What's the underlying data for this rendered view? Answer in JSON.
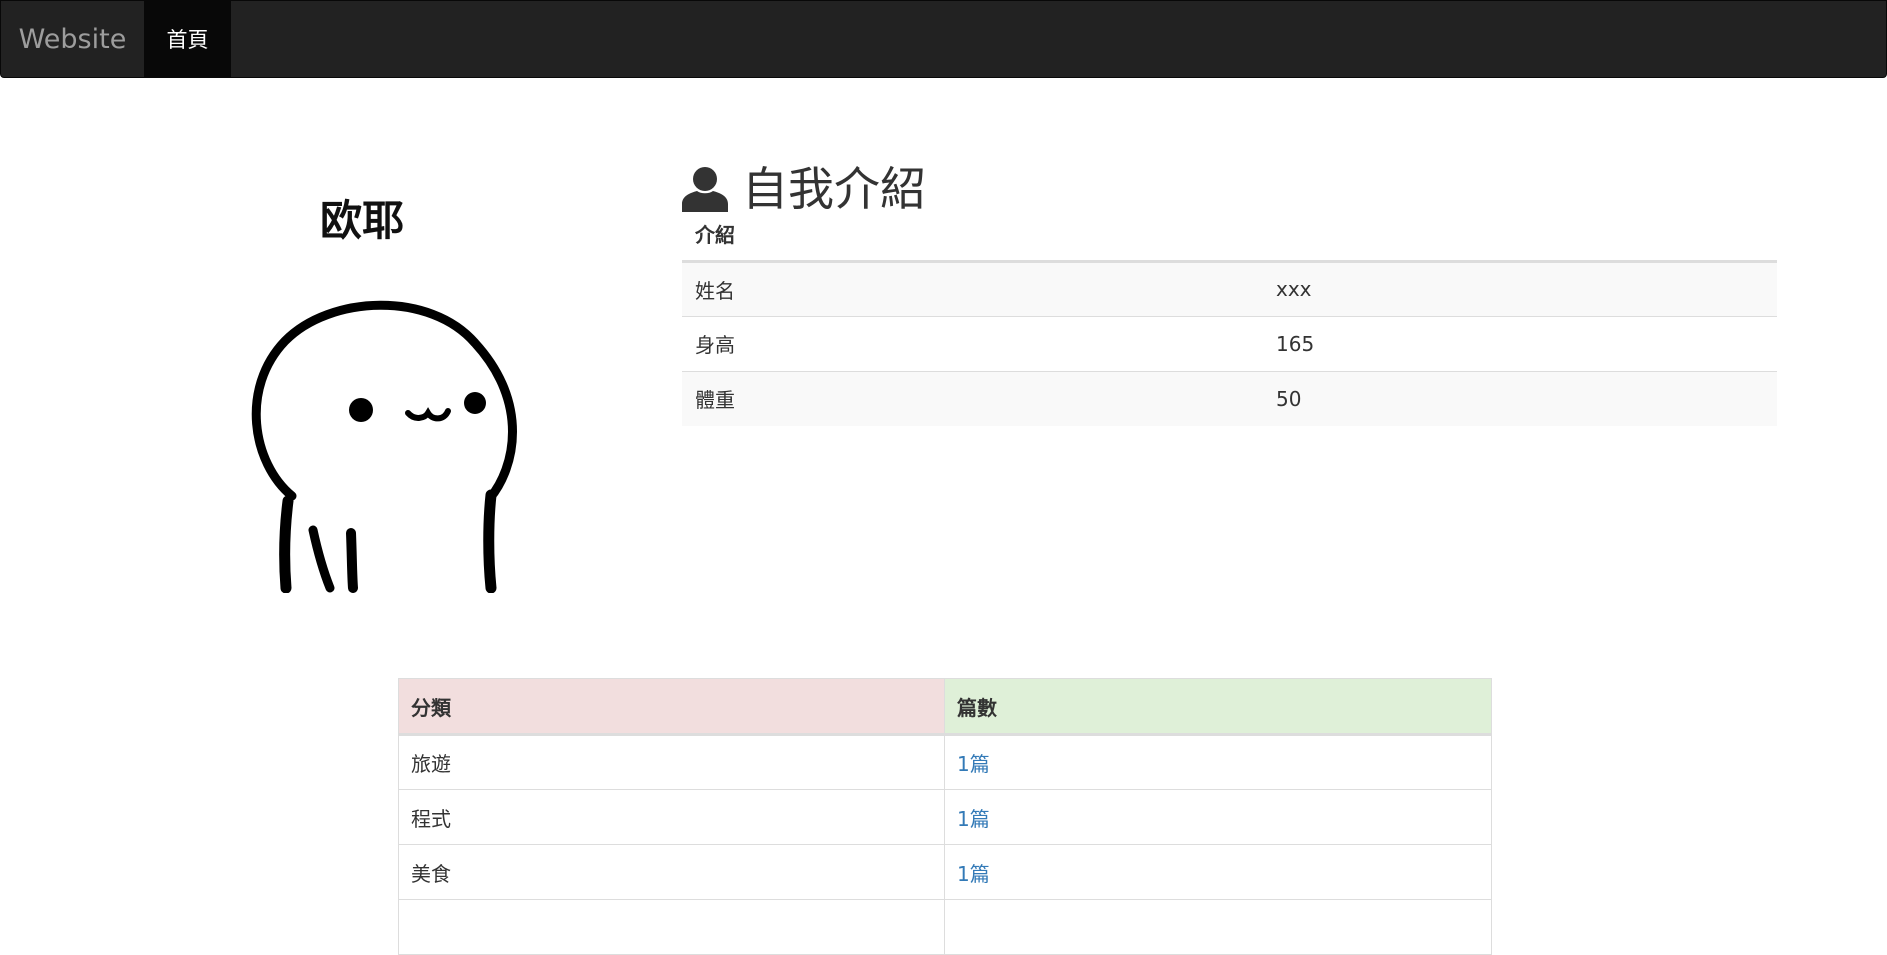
{
  "navbar": {
    "brand": "Website",
    "items": [
      {
        "label": "首頁",
        "active": true
      }
    ]
  },
  "profile": {
    "name": "欧耶"
  },
  "intro": {
    "heading": "自我介紹",
    "icon": "user-icon",
    "table_header": "介紹",
    "rows": [
      {
        "label": "姓名",
        "value": "xxx"
      },
      {
        "label": "身高",
        "value": "165"
      },
      {
        "label": "體重",
        "value": "50"
      }
    ]
  },
  "categories": {
    "headers": [
      "分類",
      "篇數"
    ],
    "rows": [
      {
        "category": "旅遊",
        "count": "1篇"
      },
      {
        "category": "程式",
        "count": "1篇"
      },
      {
        "category": "美食",
        "count": "1篇"
      }
    ]
  },
  "colors": {
    "navbar_bg": "#222222",
    "nav_active_bg": "#080808",
    "brand_text": "#9d9d9d",
    "danger_header": "#f2dede",
    "success_header": "#dff0d8",
    "link": "#337ab7"
  }
}
